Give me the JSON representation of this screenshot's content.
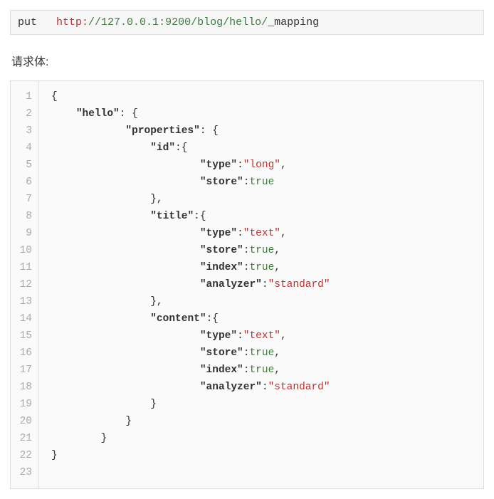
{
  "url_line": {
    "method": "put",
    "gap": "   ",
    "scheme": "http:",
    "rest": "//127.0.0.1:9200/blog/hello/",
    "suffix": "_mapping"
  },
  "section_label": "请求体:",
  "code": {
    "lines": [
      [
        {
          "t": "p",
          "v": "{"
        }
      ],
      [
        {
          "t": "p",
          "v": "    "
        },
        {
          "t": "k",
          "v": "\"hello\""
        },
        {
          "t": "p",
          "v": ": {"
        }
      ],
      [
        {
          "t": "p",
          "v": "            "
        },
        {
          "t": "k",
          "v": "\"properties\""
        },
        {
          "t": "p",
          "v": ": {"
        }
      ],
      [
        {
          "t": "p",
          "v": "                "
        },
        {
          "t": "k",
          "v": "\"id\""
        },
        {
          "t": "p",
          "v": ":{"
        }
      ],
      [
        {
          "t": "p",
          "v": "                        "
        },
        {
          "t": "k",
          "v": "\"type\""
        },
        {
          "t": "p",
          "v": ":"
        },
        {
          "t": "s",
          "v": "\"long\""
        },
        {
          "t": "p",
          "v": ","
        }
      ],
      [
        {
          "t": "p",
          "v": "                        "
        },
        {
          "t": "k",
          "v": "\"store\""
        },
        {
          "t": "p",
          "v": ":"
        },
        {
          "t": "b",
          "v": "true"
        }
      ],
      [
        {
          "t": "p",
          "v": "                },"
        }
      ],
      [
        {
          "t": "p",
          "v": "                "
        },
        {
          "t": "k",
          "v": "\"title\""
        },
        {
          "t": "p",
          "v": ":{"
        }
      ],
      [
        {
          "t": "p",
          "v": "                        "
        },
        {
          "t": "k",
          "v": "\"type\""
        },
        {
          "t": "p",
          "v": ":"
        },
        {
          "t": "s",
          "v": "\"text\""
        },
        {
          "t": "p",
          "v": ","
        }
      ],
      [
        {
          "t": "p",
          "v": "                        "
        },
        {
          "t": "k",
          "v": "\"store\""
        },
        {
          "t": "p",
          "v": ":"
        },
        {
          "t": "b",
          "v": "true"
        },
        {
          "t": "p",
          "v": ","
        }
      ],
      [
        {
          "t": "p",
          "v": "                        "
        },
        {
          "t": "k",
          "v": "\"index\""
        },
        {
          "t": "p",
          "v": ":"
        },
        {
          "t": "b",
          "v": "true"
        },
        {
          "t": "p",
          "v": ","
        }
      ],
      [
        {
          "t": "p",
          "v": "                        "
        },
        {
          "t": "k",
          "v": "\"analyzer\""
        },
        {
          "t": "p",
          "v": ":"
        },
        {
          "t": "s",
          "v": "\"standard\""
        }
      ],
      [
        {
          "t": "p",
          "v": "                },"
        }
      ],
      [
        {
          "t": "p",
          "v": "                "
        },
        {
          "t": "k",
          "v": "\"content\""
        },
        {
          "t": "p",
          "v": ":{"
        }
      ],
      [
        {
          "t": "p",
          "v": "                        "
        },
        {
          "t": "k",
          "v": "\"type\""
        },
        {
          "t": "p",
          "v": ":"
        },
        {
          "t": "s",
          "v": "\"text\""
        },
        {
          "t": "p",
          "v": ","
        }
      ],
      [
        {
          "t": "p",
          "v": "                        "
        },
        {
          "t": "k",
          "v": "\"store\""
        },
        {
          "t": "p",
          "v": ":"
        },
        {
          "t": "b",
          "v": "true"
        },
        {
          "t": "p",
          "v": ","
        }
      ],
      [
        {
          "t": "p",
          "v": "                        "
        },
        {
          "t": "k",
          "v": "\"index\""
        },
        {
          "t": "p",
          "v": ":"
        },
        {
          "t": "b",
          "v": "true"
        },
        {
          "t": "p",
          "v": ","
        }
      ],
      [
        {
          "t": "p",
          "v": "                        "
        },
        {
          "t": "k",
          "v": "\"analyzer\""
        },
        {
          "t": "p",
          "v": ":"
        },
        {
          "t": "s",
          "v": "\"standard\""
        }
      ],
      [
        {
          "t": "p",
          "v": "                }"
        }
      ],
      [
        {
          "t": "p",
          "v": "            }"
        }
      ],
      [
        {
          "t": "p",
          "v": "        }"
        }
      ],
      [
        {
          "t": "p",
          "v": "}"
        }
      ],
      [
        {
          "t": "p",
          "v": ""
        }
      ]
    ]
  }
}
